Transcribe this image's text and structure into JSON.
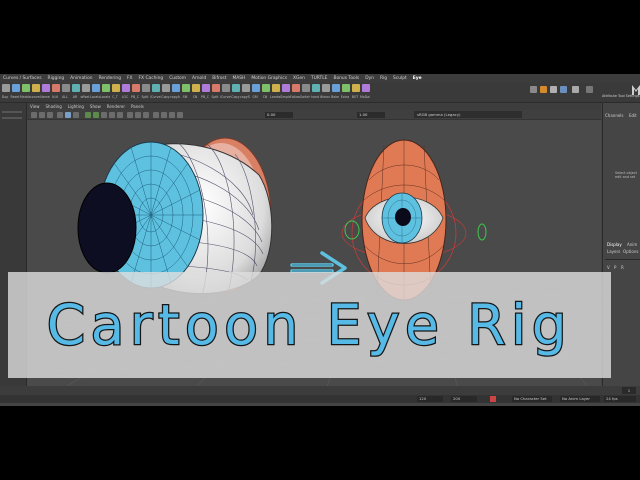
{
  "menubar": {
    "tabs": [
      "Curves / Surfaces",
      "Rigging",
      "Animation",
      "Rendering",
      "FX",
      "FX Caching",
      "Custom",
      "Arnold",
      "Bifrost",
      "MASH",
      "Motion Graphics",
      "XGen",
      "TURTLE",
      "Bonus Tools",
      "Dyn",
      "Rig",
      "Sculpt",
      "Eye"
    ],
    "active_tab": "Eye"
  },
  "shelf": {
    "labels": [
      "Dup",
      "Reset",
      "Marble",
      "convert",
      "Name",
      "N.N",
      "ALL",
      "AR",
      "offset",
      "Locator",
      "Locate",
      "C_T",
      "LOC",
      "PB_C",
      "Split",
      "iCurve",
      "iCopy",
      "copyAttr",
      "SM",
      "CN",
      "PB_C",
      "Split",
      "iCurve",
      "iCopy",
      "copySkin",
      "GM",
      "CN",
      "Lambert",
      "Simple",
      "Follow",
      "Switch",
      "hand",
      "IKmove",
      "Bake",
      "Extra",
      "BOT",
      "MoDaitem"
    ]
  },
  "status_right": {
    "labels": [
      "Attribute",
      "Tool Settings"
    ]
  },
  "panel": {
    "menu": [
      "View",
      "Shading",
      "Lighting",
      "Show",
      "Renderer",
      "Panels"
    ],
    "fields": {
      "near": "0.00",
      "far": "1.00"
    },
    "camera_label": "sRGB gamma (Legacy)"
  },
  "channel_box": {
    "header": [
      "Channels",
      "Edit"
    ],
    "hint": "Select object edit and set",
    "display_tabs": [
      "Display",
      "Anim"
    ],
    "layers": [
      "Layers",
      "Options"
    ],
    "vp_letters": [
      "V",
      "P",
      "R"
    ]
  },
  "time_slider": {
    "current_frame": "1"
  },
  "range_bar": {
    "range_start": "120",
    "range_end": "200",
    "character_set": "No Character Set",
    "anim_layer": "No Anim Layer",
    "fps": "24 fps"
  },
  "title": "Cartoon Eye Rig",
  "colors": {
    "maya_bg": "#444444",
    "viewport_bg": "#4a4a4a",
    "iris": "#5fc1e0",
    "pupil": "#0e0e22",
    "eyelid": "#e07a55",
    "title_fill": "#56b9e6",
    "title_stroke": "#161616",
    "banner": "#dedede"
  },
  "icons": [
    "arrow-right-icon",
    "control-circle-icon",
    "maya-logo-icon"
  ]
}
